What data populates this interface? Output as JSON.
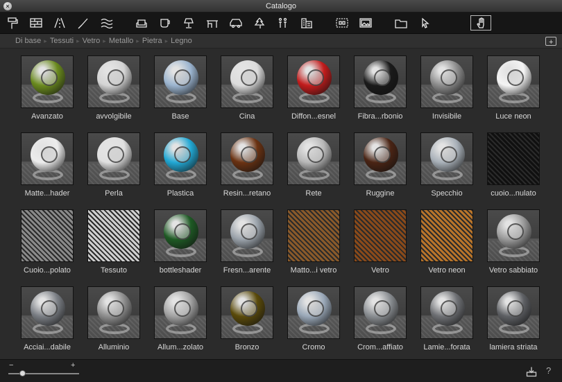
{
  "window": {
    "title": "Catalogo"
  },
  "toolbar": {
    "icons": [
      "paint-roller-icon",
      "brick-wall-icon",
      "road-icon",
      "brush-icon",
      "water-icon",
      "sofa-icon",
      "cup-icon",
      "lamp-icon",
      "desk-icon",
      "car-icon",
      "tree-icon",
      "people-icon",
      "building-icon",
      "library-icon",
      "image-icon",
      "folder-icon",
      "pointer-icon",
      "hand-icon"
    ]
  },
  "breadcrumb": {
    "items": [
      "Di base",
      "Tessuti",
      "Vetro",
      "Metallo",
      "Pietra",
      "Legno"
    ]
  },
  "materials": [
    {
      "label": "Avanzato",
      "ball": "#6a8a1e",
      "flat": false
    },
    {
      "label": "avvolgibile",
      "ball": "#d4d4d4",
      "flat": false
    },
    {
      "label": "Base",
      "ball": "#9bb4cf",
      "flat": false
    },
    {
      "label": "Cina",
      "ball": "#dcdcdc",
      "flat": false
    },
    {
      "label": "Diffon...esnel",
      "ball": "#c21c1c",
      "flat": false
    },
    {
      "label": "Fibra...rbonio",
      "ball": "#1a1a1a",
      "flat": false
    },
    {
      "label": "Invisibile",
      "ball": "#8c8c8c",
      "flat": false
    },
    {
      "label": "Luce neon",
      "ball": "#f4f4f4",
      "flat": false
    },
    {
      "label": "Matte...hader",
      "ball": "#ececec",
      "flat": false
    },
    {
      "label": "Perla",
      "ball": "#e0e0e0",
      "flat": false
    },
    {
      "label": "Plastica",
      "ball": "#22a8d4",
      "flat": false
    },
    {
      "label": "Resin...retano",
      "ball": "#6a3212",
      "flat": false
    },
    {
      "label": "Rete",
      "ball": "#b8b8b8",
      "flat": false
    },
    {
      "label": "Ruggine",
      "ball": "#4a2414",
      "flat": false
    },
    {
      "label": "Specchio",
      "ball": "#a8b0b8",
      "flat": false
    },
    {
      "label": "cuoio...nulato",
      "ball": "#101010",
      "flat": true
    },
    {
      "label": "Cuoio...polato",
      "ball": "#8a8a8a",
      "flat": true
    },
    {
      "label": "Tessuto",
      "ball": "#cfcfcf",
      "flat": true
    },
    {
      "label": "bottleshader",
      "ball": "#1e5a24",
      "flat": false
    },
    {
      "label": "Fresn...arente",
      "ball": "#9aa2aa",
      "flat": false
    },
    {
      "label": "Matto...i vetro",
      "ball": "#8a5a2a",
      "flat": true
    },
    {
      "label": "Vetro",
      "ball": "#8a4a1a",
      "flat": true
    },
    {
      "label": "Vetro neon",
      "ball": "#b8742a",
      "flat": true
    },
    {
      "label": "Vetro sabbiato",
      "ball": "#9a9a9a",
      "flat": false
    },
    {
      "label": "Acciai...dabile",
      "ball": "#7a7e84",
      "flat": false
    },
    {
      "label": "Alluminio",
      "ball": "#8e8e8e",
      "flat": false
    },
    {
      "label": "Allum...zolato",
      "ball": "#a2a2a2",
      "flat": false
    },
    {
      "label": "Bronzo",
      "ball": "#5a4a0a",
      "flat": false
    },
    {
      "label": "Cromo",
      "ball": "#9aa8b8",
      "flat": false
    },
    {
      "label": "Crom...affiato",
      "ball": "#8a8e92",
      "flat": false
    },
    {
      "label": "Lamie...forata",
      "ball": "#6e7074",
      "flat": false
    },
    {
      "label": "lamiera striata",
      "ball": "#5e6064",
      "flat": false
    }
  ],
  "bottombar": {
    "zoom_minus": "−",
    "zoom_plus": "+",
    "zoom_level": 0.2,
    "help": "?"
  }
}
